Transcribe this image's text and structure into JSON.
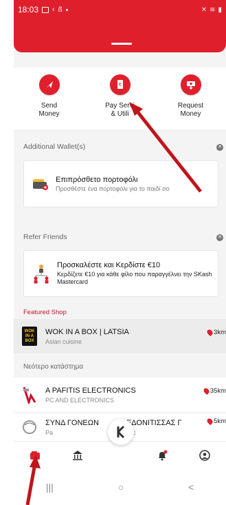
{
  "statusbar": {
    "time": "18:03"
  },
  "actions": [
    {
      "label": "Send\nMoney",
      "icon": "send-icon"
    },
    {
      "label": "Pay Servi\n& Utili",
      "icon": "bill-icon"
    },
    {
      "label": "Request\nMoney",
      "icon": "request-money-icon"
    }
  ],
  "additional_wallet": {
    "section_title": "Additional Wallet(s)",
    "card_title": "Επιπρόσθετο πορτοφόλι",
    "card_sub": "Προσθέστε ένα πορτοφόλι για το παιδί σο"
  },
  "refer": {
    "section_title": "Refer Friends",
    "card_title": "Προσκαλέστε και Κερδίστε €10",
    "card_sub": "Κερδίζετε €10 για κάθε φίλο που παραγγέλνει την SKash Mastercard"
  },
  "featured": {
    "label": "Featured Shop",
    "shop": {
      "logo_text": "WOK IN A BOX",
      "name": "WOK IN A BOX | LATSIA",
      "category": "Asian cuisine",
      "distance": "3km"
    }
  },
  "newest": {
    "label": "Νεότερο κατάστημα",
    "shops": [
      {
        "name": "A PAFITIS ELECTRONICS",
        "category": "PC AND ELECTRONICS",
        "distance": "35km"
      },
      {
        "name": "ΣΥΝΔ ΓΟΝΕΩΝ",
        "name_tail": "ΕΔΟΝΙΤΙΣΣΑΣ Γ",
        "category": "Pa",
        "category_tail": "ssc",
        "distance": "5km"
      }
    ]
  },
  "bottom_nav": [
    "wallet-icon",
    "bank-icon",
    "scan-icon",
    "bell-icon",
    "profile-icon"
  ],
  "system_nav": {
    "recents": "|||",
    "home": "○",
    "back": "<"
  },
  "colors": {
    "brand": "#e01f2d",
    "arrow": "#c0151b"
  }
}
